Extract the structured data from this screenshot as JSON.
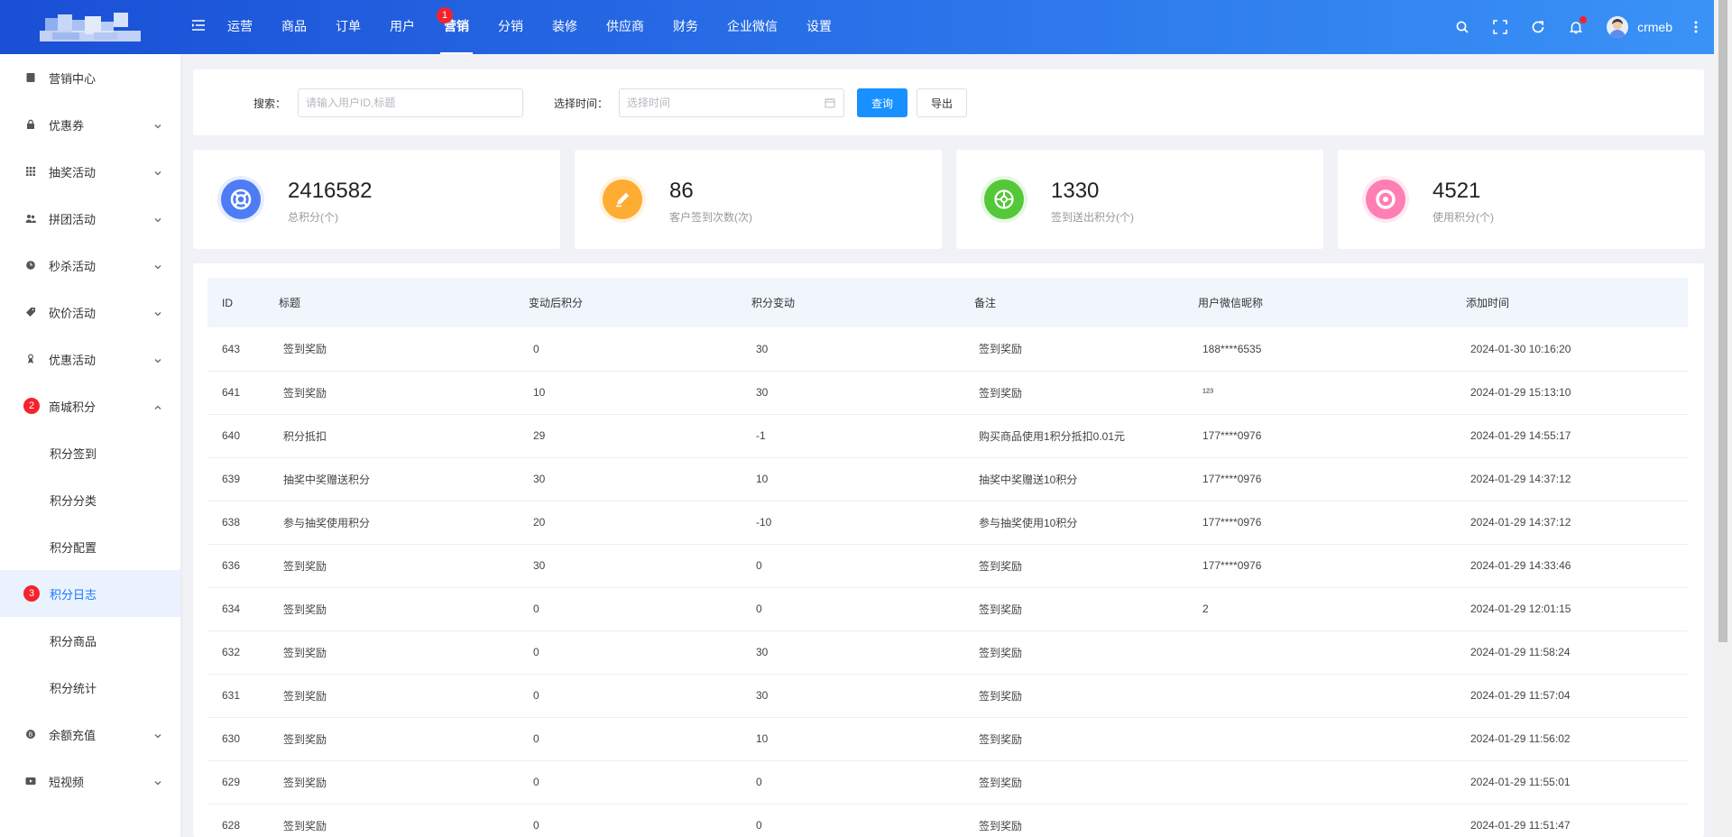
{
  "topnav": {
    "items": [
      "运营",
      "商品",
      "订单",
      "用户",
      "营销",
      "分销",
      "装修",
      "供应商",
      "财务",
      "企业微信",
      "设置"
    ],
    "active_index": 4,
    "active_badge": "1"
  },
  "user": {
    "name": "crmeb"
  },
  "sidebar": {
    "items": [
      {
        "label": "营销中心",
        "icon": "document-icon",
        "expandable": false
      },
      {
        "label": "优惠券",
        "icon": "lock-icon",
        "expandable": true
      },
      {
        "label": "抽奖活动",
        "icon": "grid-icon",
        "expandable": true
      },
      {
        "label": "拼团活动",
        "icon": "group-icon",
        "expandable": true
      },
      {
        "label": "秒杀活动",
        "icon": "clock-icon",
        "expandable": true
      },
      {
        "label": "砍价活动",
        "icon": "tag-icon",
        "expandable": true
      },
      {
        "label": "优惠活动",
        "icon": "gift-icon",
        "expandable": true
      },
      {
        "label": "商城积分",
        "icon": "points-icon",
        "expandable": true,
        "expanded": true,
        "badge": "2"
      }
    ],
    "subitems": [
      {
        "label": "积分签到"
      },
      {
        "label": "积分分类"
      },
      {
        "label": "积分配置"
      },
      {
        "label": "积分日志",
        "active": true,
        "badge": "3"
      },
      {
        "label": "积分商品"
      },
      {
        "label": "积分统计"
      }
    ],
    "bottom_items": [
      {
        "label": "余额充值",
        "icon": "coin-icon"
      },
      {
        "label": "短视频",
        "icon": "video-icon"
      }
    ]
  },
  "search": {
    "keyword_label": "搜索：",
    "keyword_placeholder": "请输入用户ID,标题",
    "date_label": "选择时间：",
    "date_placeholder": "选择时间",
    "query_button": "查询",
    "export_button": "导出"
  },
  "stats": [
    {
      "value": "2416582",
      "label": "总积分(个)",
      "color": "#4d7cf5",
      "ring": "#e6edfe",
      "icon": "lifebuoy-icon"
    },
    {
      "value": "86",
      "label": "客户签到次数(次)",
      "color": "#ffac33",
      "ring": "#fff3e0",
      "icon": "pencil-icon"
    },
    {
      "value": "1330",
      "label": "签到送出积分(个)",
      "color": "#54c839",
      "ring": "#e7f7e3",
      "icon": "wheel-icon"
    },
    {
      "value": "4521",
      "label": "使用积分(个)",
      "color": "#ff7eb3",
      "ring": "#ffe9f2",
      "icon": "donut-icon"
    }
  ],
  "table": {
    "columns": [
      "ID",
      "标题",
      "变动后积分",
      "积分变动",
      "备注",
      "用户微信昵称",
      "添加时间"
    ],
    "rows": [
      [
        "643",
        "签到奖励",
        "0",
        "30",
        "签到奖励",
        "188****6535",
        "2024-01-30 10:16:20"
      ],
      [
        "641",
        "签到奖励",
        "10",
        "30",
        "签到奖励",
        "¹²³",
        "2024-01-29 15:13:10"
      ],
      [
        "640",
        "积分抵扣",
        "29",
        "-1",
        "购买商品使用1积分抵扣0.01元",
        "177****0976",
        "2024-01-29 14:55:17"
      ],
      [
        "639",
        "抽奖中奖赠送积分",
        "30",
        "10",
        "抽奖中奖赠送10积分",
        "177****0976",
        "2024-01-29 14:37:12"
      ],
      [
        "638",
        "参与抽奖使用积分",
        "20",
        "-10",
        "参与抽奖使用10积分",
        "177****0976",
        "2024-01-29 14:37:12"
      ],
      [
        "636",
        "签到奖励",
        "30",
        "0",
        "签到奖励",
        "177****0976",
        "2024-01-29 14:33:46"
      ],
      [
        "634",
        "签到奖励",
        "0",
        "0",
        "签到奖励",
        "2",
        "2024-01-29 12:01:15"
      ],
      [
        "632",
        "签到奖励",
        "0",
        "30",
        "签到奖励",
        "",
        "2024-01-29 11:58:24"
      ],
      [
        "631",
        "签到奖励",
        "0",
        "30",
        "签到奖励",
        "",
        "2024-01-29 11:57:04"
      ],
      [
        "630",
        "签到奖励",
        "0",
        "10",
        "签到奖励",
        "",
        "2024-01-29 11:56:02"
      ],
      [
        "629",
        "签到奖励",
        "0",
        "0",
        "签到奖励",
        "",
        "2024-01-29 11:55:01"
      ],
      [
        "628",
        "签到奖励",
        "0",
        "0",
        "签到奖励",
        "",
        "2024-01-29 11:51:47"
      ]
    ]
  }
}
